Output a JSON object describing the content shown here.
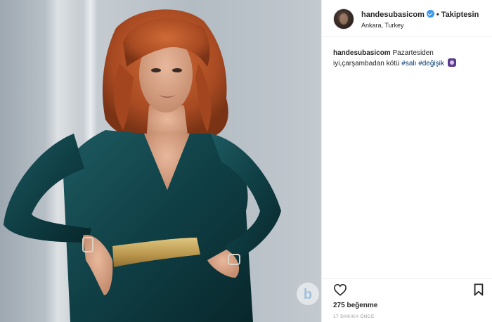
{
  "post": {
    "username": "handesubasicom",
    "follow_status": "Takiptesin",
    "location": "Ankara, Turkey",
    "caption": {
      "username": "handesubasicom",
      "text_line1": "Pazartesiden",
      "text_line2": "iyi,çarşambadan kötü",
      "tags": [
        "#salı",
        "#değişik"
      ],
      "emoji": "purple-square-emoji"
    },
    "likes_label": "275 beğenme",
    "timestamp": "17 DAKİKA ÖNCE"
  },
  "icons": {
    "verified": "verified-badge-icon",
    "like": "heart-icon",
    "save": "bookmark-icon"
  },
  "colors": {
    "verified_blue": "#3897f0",
    "hashtag": "#003569",
    "dress": "#0f3f45",
    "hair": "#b2532a",
    "belt": "#c7a65c"
  }
}
